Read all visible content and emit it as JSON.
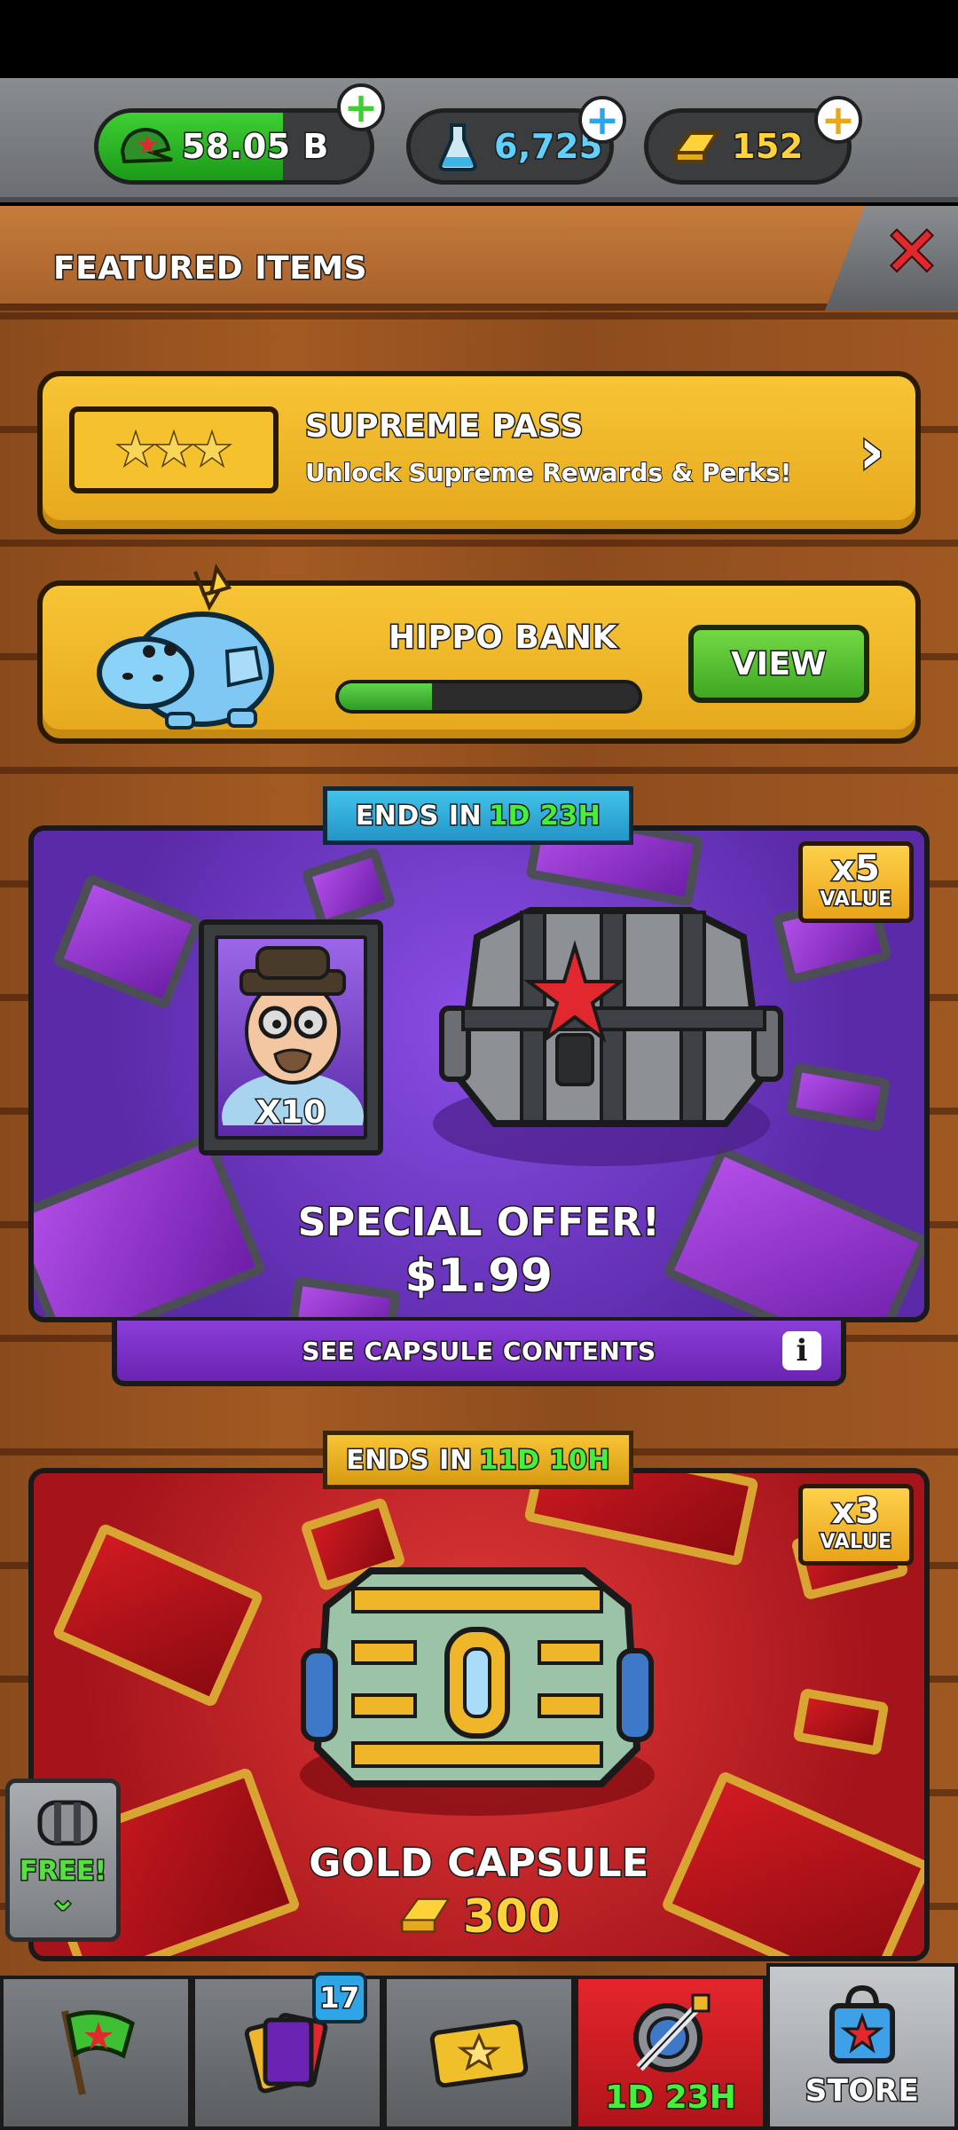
{
  "currencies": {
    "cash": {
      "value": "58.05 B",
      "icon": "army-cap-icon",
      "fill_fraction": 0.68
    },
    "science": {
      "value": "6,725",
      "icon": "flask-icon"
    },
    "gold": {
      "value": "152",
      "icon": "gold-bar-icon"
    }
  },
  "header": {
    "title": "FEATURED ITEMS"
  },
  "supreme_pass": {
    "title": "SUPREME PASS",
    "subtitle": "Unlock Supreme Rewards & Perks!"
  },
  "hippo_bank": {
    "title": "HIPPO BANK",
    "progress": 0.31,
    "button": "VIEW"
  },
  "offer_special": {
    "ribbon_prefix": "ENDS IN",
    "ribbon_time": "1D 23H",
    "value_multiplier": "x5",
    "value_label": "VALUE",
    "card_count": "X10",
    "title": "SPECIAL OFFER!",
    "price": "$1.99",
    "contents_label": "SEE CAPSULE CONTENTS"
  },
  "offer_gold": {
    "ribbon_prefix": "ENDS IN",
    "ribbon_time": "11D 10H",
    "value_multiplier": "x3",
    "value_label": "VALUE",
    "title": "GOLD CAPSULE",
    "price": "300"
  },
  "free_tab": {
    "label": "FREE!"
  },
  "nav": {
    "cards_badge": "17",
    "event_timer": "1D 23H",
    "store_label": "STORE"
  },
  "colors": {
    "accent_green": "#46f03a",
    "panel_yellow": "#f7c536",
    "offer_purple": "#6a23b2",
    "offer_red": "#c2161c"
  }
}
